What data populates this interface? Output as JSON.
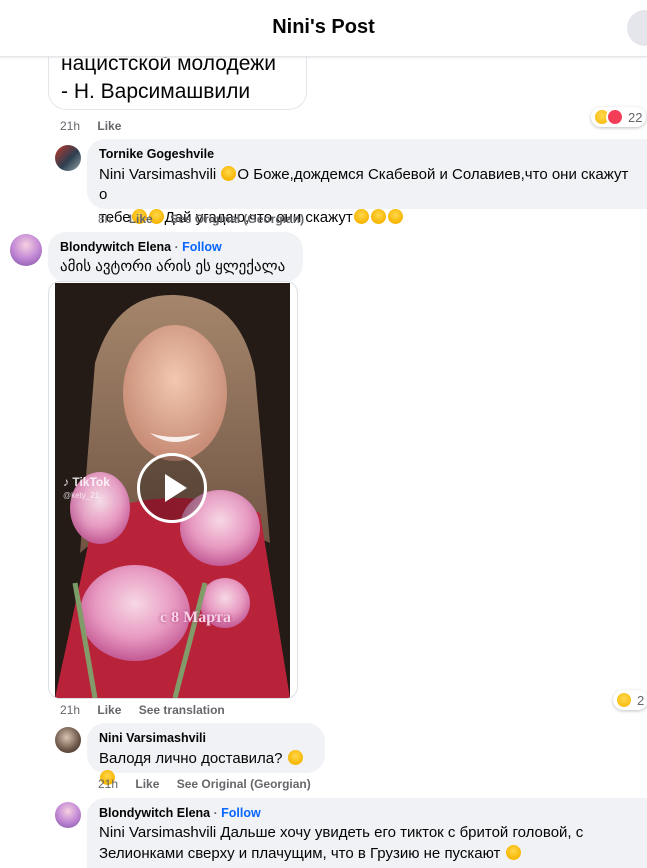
{
  "header": {
    "title": "Nini's Post"
  },
  "top_bubble": {
    "line1": "нацистской молодежи",
    "line2": "- Н. Варсимашвили"
  },
  "comments": [
    {
      "meta": {
        "time": "21h",
        "like": "Like"
      },
      "reaction_count": "22"
    },
    {
      "author": "Tornike Gogeshvile",
      "mention": "Nini Varsimashvili",
      "text1": "О Боже,дождемся Скабевой и Солавиев,что они скажут о",
      "text2a": "тебе",
      "text2b": "Дай угадаю,что они скажут",
      "meta": {
        "time": "8h",
        "like": "Like",
        "extra": "See Original (Georgian)"
      }
    },
    {
      "author": "Blondywitch Elena",
      "dot": "·",
      "follow": "Follow",
      "text": "ამის ავტორი არის ეს ყლექალა",
      "video": {
        "tiktok_label": "TikTok",
        "tiktok_handle": "@kety_21",
        "overlay_text": "с 8 Марта"
      },
      "meta": {
        "time": "21h",
        "like": "Like",
        "extra": "See translation"
      },
      "reaction_count": "2"
    },
    {
      "author": "Nini Varsimashvili",
      "text": "Валодя лично доставила?",
      "meta": {
        "time": "21h",
        "like": "Like",
        "extra": "See Original (Georgian)"
      }
    },
    {
      "author": "Blondywitch Elena",
      "dot": "·",
      "follow": "Follow",
      "mention": "Nini Varsimashvili",
      "text1": "Дальше хочу увидеть его тикток с бритой головой, с",
      "text2": "Зелионками сверху и плачущим, что в Грузию не пускают"
    }
  ],
  "colors": {
    "accent": "#0866ff",
    "bubble": "#f0f2f5",
    "meta": "#65676b",
    "heart": "#f33e58",
    "emoji": "#f7b500"
  },
  "icons": [
    "close-icon",
    "play-icon",
    "laugh-emoji-icon",
    "heart-icon",
    "crying-emoji-icon",
    "tiktok-icon"
  ]
}
